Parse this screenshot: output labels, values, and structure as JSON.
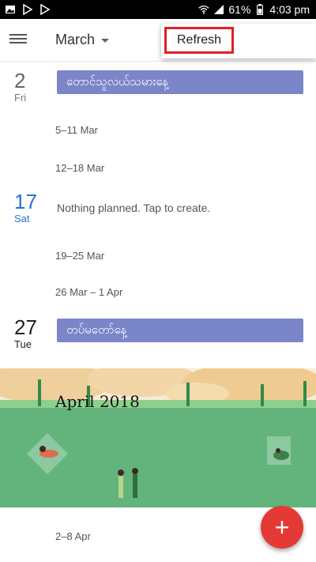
{
  "status_bar": {
    "battery": "61%",
    "time": "4:03 pm",
    "icons": [
      "photo-icon",
      "play-store-icon",
      "play-store-icon",
      "wifi-icon",
      "signal-icon",
      "battery-icon"
    ]
  },
  "app_bar": {
    "month": "March",
    "menu_icon": "hamburger-icon",
    "overflow": {
      "refresh_label": "Refresh"
    }
  },
  "agenda": {
    "day2": {
      "num": "2",
      "name": "Fri",
      "event": "တောင်သူလယ်သမားနေ့"
    },
    "week1": "5–11 Mar",
    "week2": "12–18 Mar",
    "day17": {
      "num": "17",
      "name": "Sat",
      "text": "Nothing planned. Tap to create."
    },
    "week3": "19–25 Mar",
    "week4": "26 Mar – 1 Apr",
    "day27": {
      "num": "27",
      "name": "Tue",
      "event": "တပ်မတော်နေ့"
    },
    "banner_title": "April 2018",
    "week5": "2–8 Apr"
  },
  "fab": {
    "label": "+"
  },
  "colors": {
    "event": "#7b86c9",
    "today": "#2a6fd6",
    "fab": "#e53935",
    "highlight": "#e0202a"
  }
}
